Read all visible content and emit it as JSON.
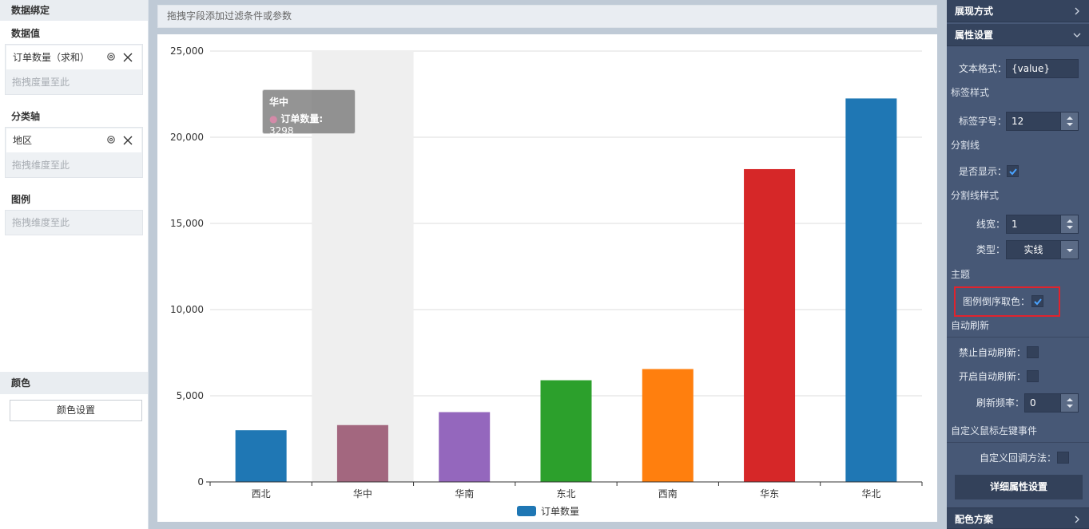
{
  "left_panel": {
    "header": "数据绑定",
    "data_values": {
      "title": "数据值",
      "pill": "订单数量（求和）",
      "placeholder": "拖拽度量至此"
    },
    "category_axis": {
      "title": "分类轴",
      "pill": "地区",
      "placeholder": "拖拽维度至此"
    },
    "legend": {
      "title": "图例",
      "placeholder": "拖拽维度至此"
    },
    "color": {
      "title": "颜色",
      "button": "颜色设置"
    }
  },
  "filter_bar": {
    "placeholder": "拖拽字段添加过滤条件或参数"
  },
  "chart_data": {
    "type": "bar",
    "categories": [
      "西北",
      "华中",
      "华南",
      "东北",
      "西南",
      "华东",
      "华北"
    ],
    "values": [
      3000,
      3298,
      4050,
      5900,
      6550,
      18150,
      22250
    ],
    "colors": [
      "#1f77b4",
      "#a3677f",
      "#9467bd",
      "#2ca02c",
      "#ff7f0e",
      "#d62728",
      "#1f77b4"
    ],
    "ylim": [
      0,
      25000
    ],
    "yticks": [
      0,
      5000,
      10000,
      15000,
      20000,
      25000
    ],
    "ytick_labels": [
      "0",
      "5,000",
      "10,000",
      "15,000",
      "20,000",
      "25,000"
    ],
    "grid": true,
    "highlighted_category": "华中",
    "legend": {
      "label": "订单数量",
      "color": "#1f77b4",
      "position": "bottom-center"
    },
    "tooltip": {
      "title": "华中",
      "label": "订单数量",
      "value": "3298"
    }
  },
  "right_panel": {
    "sections": {
      "display_mode": "展现方式",
      "property_settings": "属性设置",
      "color_scheme": "配色方案"
    },
    "text_format": {
      "label": "文本格式：",
      "value": "{value}"
    },
    "label_style": "标签样式",
    "label_font_size": {
      "label": "标签字号：",
      "value": "12"
    },
    "split_line": "分割线",
    "show": {
      "label": "是否显示：",
      "checked": true
    },
    "split_line_style": "分割线样式",
    "line_width": {
      "label": "线宽：",
      "value": "1"
    },
    "line_type": {
      "label": "类型：",
      "value": "实线"
    },
    "theme": "主题",
    "legend_reverse": {
      "label": "图例倒序取色：",
      "checked": true
    },
    "auto_refresh": "自动刷新",
    "disable_auto_refresh": {
      "label": "禁止自动刷新：",
      "checked": false
    },
    "enable_auto_refresh": {
      "label": "开启自动刷新：",
      "checked": false
    },
    "refresh_rate": {
      "label": "刷新频率：",
      "value": "0"
    },
    "custom_click_event": "自定义鼠标左键事件",
    "custom_callback": {
      "label": "自定义回调方法：",
      "checked": false
    },
    "detail_button": "详细属性设置"
  },
  "colors": {
    "right_panel_bg": "#475876",
    "right_panel_header": "#35445e",
    "highlight_border": "#e0232d"
  }
}
